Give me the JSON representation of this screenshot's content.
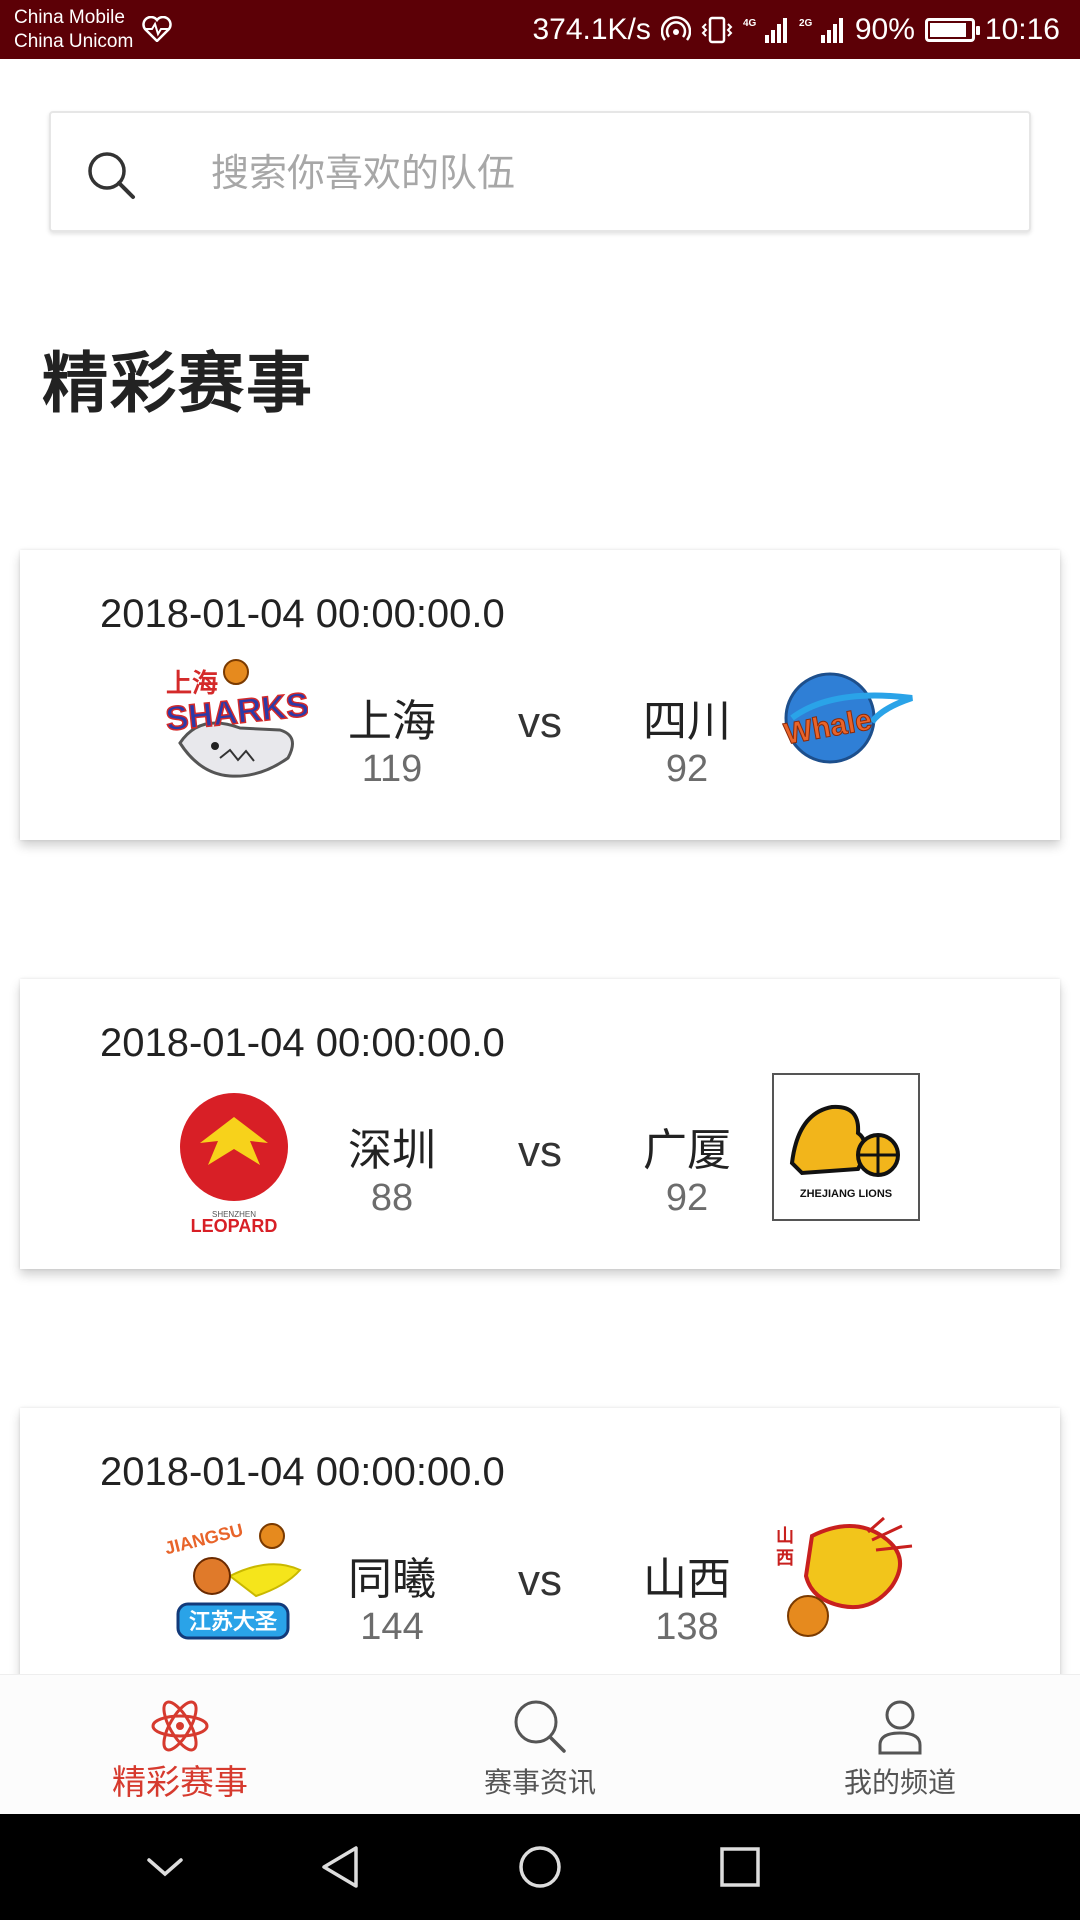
{
  "status_bar": {
    "carrier_1": "China Mobile",
    "carrier_2": "China Unicom",
    "net_speed": "374.1K/s",
    "battery": "90%",
    "battery_level": 0.9,
    "time": "10:16",
    "icons": [
      "heart-pulse-icon",
      "hotspot-icon",
      "vibrate-icon",
      "signal-4g-icon",
      "signal-2g-icon",
      "battery-icon"
    ]
  },
  "search": {
    "placeholder": "搜索你喜欢的队伍",
    "value": "",
    "icon": "search-icon"
  },
  "page_title": "精彩赛事",
  "matches": [
    {
      "date": "2018-01-04 00:00:00.0",
      "home": {
        "name": "上海",
        "score": "119",
        "logo": "shanghai-sharks-logo"
      },
      "vs": "vs",
      "away": {
        "name": "四川",
        "score": "92",
        "logo": "sichuan-whales-logo"
      }
    },
    {
      "date": "2018-01-04 00:00:00.0",
      "home": {
        "name": "深圳",
        "score": "88",
        "logo": "shenzhen-leopards-logo"
      },
      "vs": "vs",
      "away": {
        "name": "广厦",
        "score": "92",
        "logo": "zhejiang-lions-logo"
      }
    },
    {
      "date": "2018-01-04 00:00:00.0",
      "home": {
        "name": "同曦",
        "score": "144",
        "logo": "jiangsu-monkey-kings-logo"
      },
      "vs": "vs",
      "away": {
        "name": "山西",
        "score": "138",
        "logo": "shanxi-dragons-logo"
      }
    }
  ],
  "tab_bar": [
    {
      "label": "精彩赛事",
      "icon": "atom-icon",
      "active": true
    },
    {
      "label": "赛事资讯",
      "icon": "search-icon",
      "active": false
    },
    {
      "label": "我的频道",
      "icon": "user-icon",
      "active": false
    }
  ],
  "colors": {
    "status_bar_bg": "#5c0006",
    "accent": "#d63a2e",
    "score_gray": "#6c6c6c",
    "placeholder_gray": "#a7a7a7"
  },
  "nav_bar": {
    "icons": [
      "chevron-down-icon",
      "back-icon",
      "home-icon",
      "recents-icon"
    ]
  }
}
